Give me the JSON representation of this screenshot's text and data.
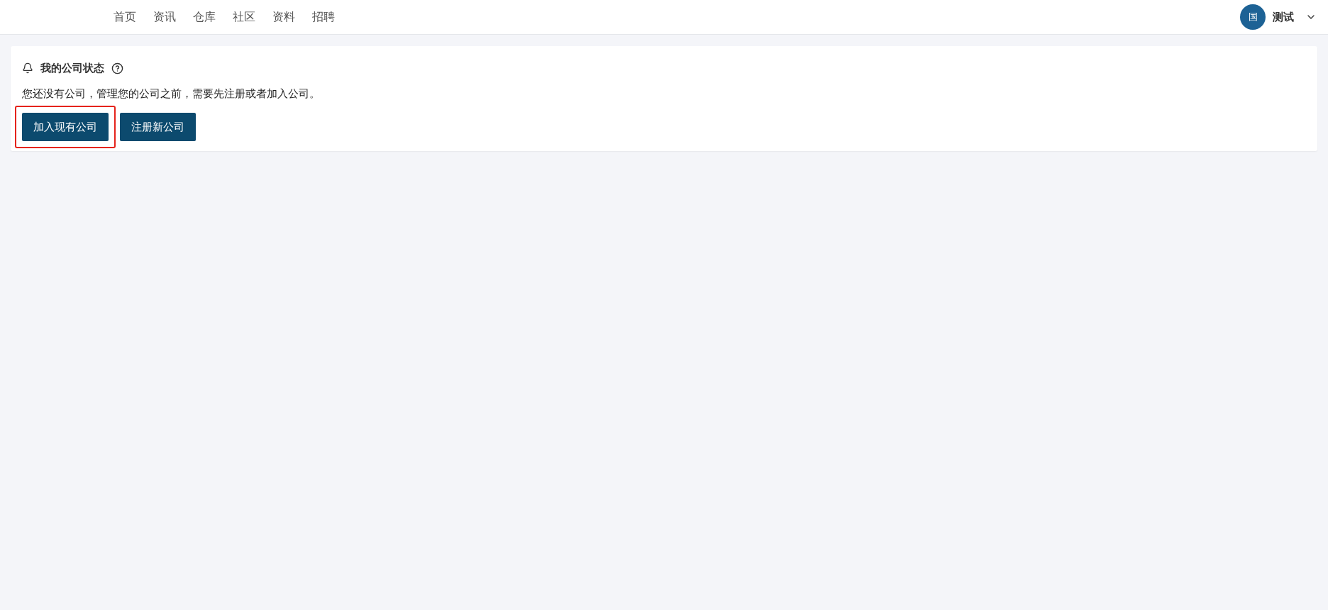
{
  "nav": {
    "items": [
      {
        "label": "首页"
      },
      {
        "label": "资讯"
      },
      {
        "label": "仓库"
      },
      {
        "label": "社区"
      },
      {
        "label": "资料"
      },
      {
        "label": "招聘"
      }
    ]
  },
  "user": {
    "avatar": "国",
    "name": "测试"
  },
  "card": {
    "title": "我的公司状态",
    "message": "您还没有公司，管理您的公司之前，需要先注册或者加入公司。",
    "buttons": [
      {
        "label": "加入现有公司",
        "highlighted": true
      },
      {
        "label": "注册新公司",
        "highlighted": false
      }
    ]
  }
}
